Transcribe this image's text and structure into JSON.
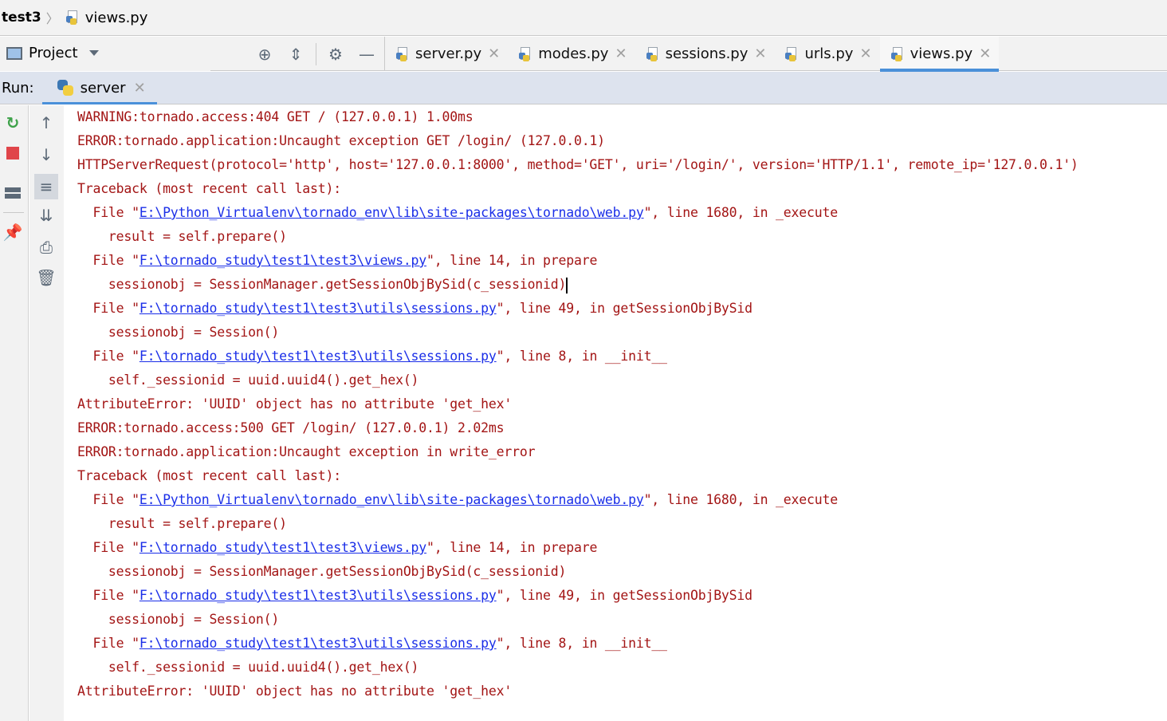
{
  "breadcrumb": {
    "project": "test3",
    "file": "views.py"
  },
  "project_panel": {
    "label": "Project"
  },
  "tabs": [
    {
      "label": "server.py",
      "active": false
    },
    {
      "label": "modes.py",
      "active": false
    },
    {
      "label": "sessions.py",
      "active": false
    },
    {
      "label": "urls.py",
      "active": false
    },
    {
      "label": "views.py",
      "active": true
    }
  ],
  "run": {
    "label": "Run:",
    "tab": "server"
  },
  "colors": {
    "error_text": "#a31515",
    "link": "#1a2ee8",
    "accent": "#4a90d9",
    "run_bar": "#dde3ee"
  },
  "console": {
    "lines": [
      {
        "text": "WARNING:tornado.access:404 GET / (127.0.0.1) 1.00ms"
      },
      {
        "text": "ERROR:tornado.application:Uncaught exception GET /login/ (127.0.0.1)"
      },
      {
        "text": "HTTPServerRequest(protocol='http', host='127.0.0.1:8000', method='GET', uri='/login/', version='HTTP/1.1', remote_ip='127.0.0.1')"
      },
      {
        "text": "Traceback (most recent call last):"
      },
      {
        "pre": "  File \"",
        "link": "E:\\Python_Virtualenv\\tornado_env\\lib\\site-packages\\tornado\\web.py",
        "post": "\", line 1680, in _execute"
      },
      {
        "text": "    result = self.prepare()"
      },
      {
        "pre": "  File \"",
        "link": "F:\\tornado_study\\test1\\test3\\views.py",
        "post": "\", line 14, in prepare"
      },
      {
        "text": "    sessionobj = SessionManager.getSessionObjBySid(c_sessionid)",
        "caret": true
      },
      {
        "pre": "  File \"",
        "link": "F:\\tornado_study\\test1\\test3\\utils\\sessions.py",
        "post": "\", line 49, in getSessionObjBySid"
      },
      {
        "text": "    sessionobj = Session()"
      },
      {
        "pre": "  File \"",
        "link": "F:\\tornado_study\\test1\\test3\\utils\\sessions.py",
        "post": "\", line 8, in __init__"
      },
      {
        "text": "    self._sessionid = uuid.uuid4().get_hex()"
      },
      {
        "text": "AttributeError: 'UUID' object has no attribute 'get_hex'"
      },
      {
        "text": "ERROR:tornado.access:500 GET /login/ (127.0.0.1) 2.02ms"
      },
      {
        "text": "ERROR:tornado.application:Uncaught exception in write_error"
      },
      {
        "text": "Traceback (most recent call last):"
      },
      {
        "pre": "  File \"",
        "link": "E:\\Python_Virtualenv\\tornado_env\\lib\\site-packages\\tornado\\web.py",
        "post": "\", line 1680, in _execute"
      },
      {
        "text": "    result = self.prepare()"
      },
      {
        "pre": "  File \"",
        "link": "F:\\tornado_study\\test1\\test3\\views.py",
        "post": "\", line 14, in prepare"
      },
      {
        "text": "    sessionobj = SessionManager.getSessionObjBySid(c_sessionid)"
      },
      {
        "pre": "  File \"",
        "link": "F:\\tornado_study\\test1\\test3\\utils\\sessions.py",
        "post": "\", line 49, in getSessionObjBySid"
      },
      {
        "text": "    sessionobj = Session()"
      },
      {
        "pre": "  File \"",
        "link": "F:\\tornado_study\\test1\\test3\\utils\\sessions.py",
        "post": "\", line 8, in __init__"
      },
      {
        "text": "    self._sessionid = uuid.uuid4().get_hex()"
      },
      {
        "text": "AttributeError: 'UUID' object has no attribute 'get_hex'"
      }
    ]
  }
}
